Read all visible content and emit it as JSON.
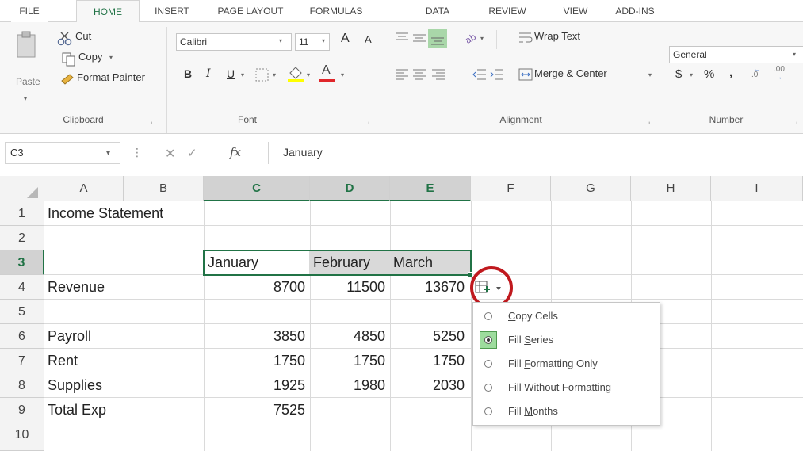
{
  "ribbon_tabs": [
    "FILE",
    "HOME",
    "INSERT",
    "PAGE LAYOUT",
    "FORMULAS",
    "DATA",
    "REVIEW",
    "VIEW",
    "ADD-INS"
  ],
  "active_tab": "HOME",
  "clipboard": {
    "paste": "Paste",
    "cut": "Cut",
    "copy": "Copy",
    "format_painter": "Format Painter",
    "group_label": "Clipboard"
  },
  "font": {
    "family": "Calibri",
    "size": "11",
    "bold": "B",
    "italic": "I",
    "underline": "U",
    "grow": "A",
    "shrink": "A",
    "font_color": "A",
    "group_label": "Font"
  },
  "alignment": {
    "wrap_text": "Wrap Text",
    "merge_center": "Merge & Center",
    "group_label": "Alignment"
  },
  "number": {
    "format": "General",
    "currency": "$",
    "percent": "%",
    "comma": ",",
    "increase_decimal": ".00",
    "decrease_decimal": ".0",
    "group_label": "Number"
  },
  "formula_bar": {
    "name_box": "C3",
    "fx": "fx",
    "content": "January"
  },
  "columns": [
    "A",
    "B",
    "C",
    "D",
    "E",
    "F",
    "G",
    "H",
    "I"
  ],
  "rows": [
    "1",
    "2",
    "3",
    "4",
    "5",
    "6",
    "7",
    "8",
    "9",
    "10"
  ],
  "cells": {
    "A1": "Income Statement",
    "C3": "January",
    "D3": "February",
    "E3": "March",
    "A4": "Revenue",
    "C4": "8700",
    "D4": "11500",
    "E4": "13670",
    "A6": "Payroll",
    "C6": "3850",
    "D6": "4850",
    "E6": "5250",
    "A7": "Rent",
    "C7": "1750",
    "D7": "1750",
    "E7": "1750",
    "A8": "Supplies",
    "C8": "1925",
    "D8": "1980",
    "E8": "2030",
    "A9": "Total Exp",
    "C9": "7525"
  },
  "autofill_menu": {
    "items": [
      {
        "pre": "",
        "key": "C",
        "post": "opy Cells",
        "selected": false
      },
      {
        "pre": "Fill ",
        "key": "S",
        "post": "eries",
        "selected": true
      },
      {
        "pre": "Fill ",
        "key": "F",
        "post": "ormatting Only",
        "selected": false
      },
      {
        "pre": "Fill Witho",
        "key": "u",
        "post": "t Formatting",
        "selected": false
      },
      {
        "pre": "Fill ",
        "key": "M",
        "post": "onths",
        "selected": false
      }
    ]
  },
  "colors": {
    "accent": "#217346",
    "highlight_circle": "#c0191e",
    "font_color_bar": "#e0262a",
    "fill_color_bar": "#ffff00"
  }
}
